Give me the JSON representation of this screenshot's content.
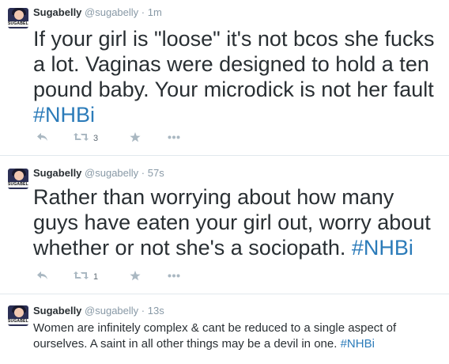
{
  "tweets": [
    {
      "name": "Sugabelly",
      "handle": "@sugabelly",
      "separator": "·",
      "time": "1m",
      "avatar_label": "SUGABELLY",
      "text": "If your girl is \"loose\" it's not bcos she fucks a lot. Vaginas were designed to hold a ten pound baby. Your microdick is not her fault ",
      "hashtag": "#NHBi",
      "retweet_count": "3"
    },
    {
      "name": "Sugabelly",
      "handle": "@sugabelly",
      "separator": "·",
      "time": "57s",
      "avatar_label": "SUGABELLY",
      "text": "Rather than worrying about how many guys have eaten your girl out, worry about whether or not she's a sociopath. ",
      "hashtag": "#NHBi",
      "retweet_count": "1"
    },
    {
      "name": "Sugabelly",
      "handle": "@sugabelly",
      "separator": "·",
      "time": "13s",
      "avatar_label": "SUGABELLY",
      "text": "Women are infinitely complex & cant be reduced to a single aspect of ourselves. A saint in all other things may be a devil in one. ",
      "hashtag": "#NHBi"
    }
  ],
  "icons": {
    "reply": "reply-icon",
    "retweet": "retweet-icon",
    "favorite": "star-icon",
    "more": "more-icon"
  },
  "colors": {
    "hashtag": "#2b7bb9",
    "muted": "#8899a6",
    "icon": "#aab8c2"
  }
}
